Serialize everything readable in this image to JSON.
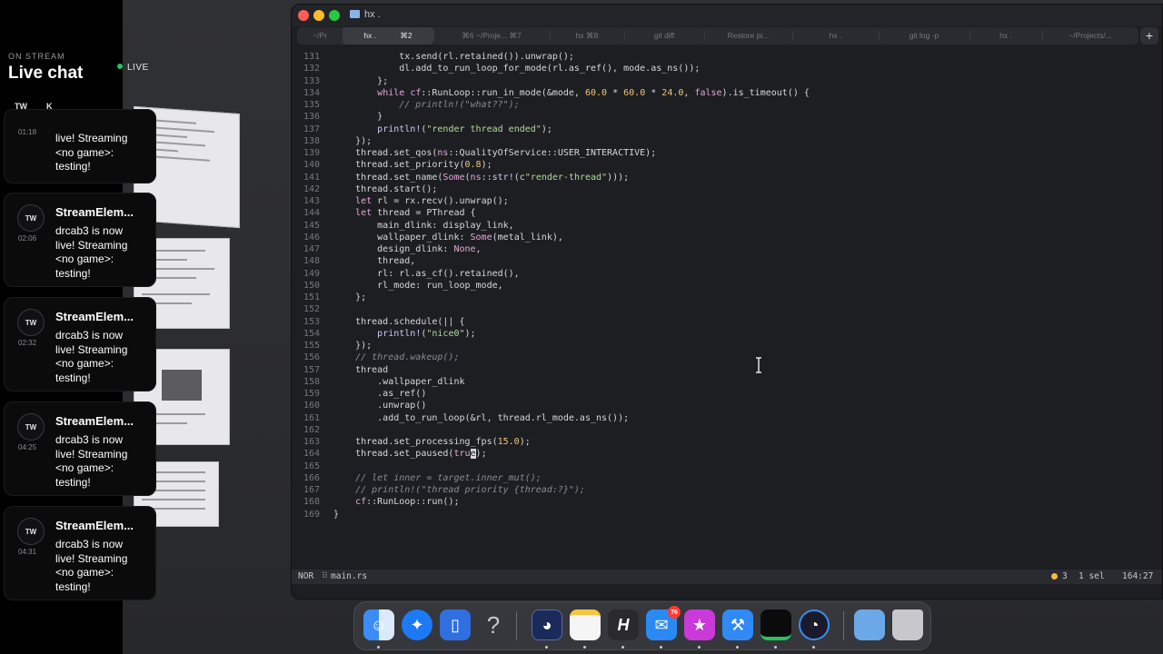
{
  "overlay": {
    "on_stream": "ON STREAM",
    "title": "Live chat",
    "live": "LIVE",
    "tabs": [
      "TW",
      "K"
    ],
    "messages": [
      {
        "platform": "TW",
        "time": "01:18",
        "name": "",
        "text": "live! Streaming <no game>: testing!"
      },
      {
        "platform": "TW",
        "time": "02:06",
        "name": "StreamElem...",
        "text": "drcab3 is now live! Streaming <no game>: testing!"
      },
      {
        "platform": "TW",
        "time": "02:32",
        "name": "StreamElem...",
        "text": "drcab3 is now live! Streaming <no game>: testing!"
      },
      {
        "platform": "TW",
        "time": "04:25",
        "name": "StreamElem...",
        "text": "drcab3 is now live! Streaming <no game>: testing!"
      },
      {
        "platform": "TW",
        "time": "04:31",
        "name": "StreamElem...",
        "text": "drcab3 is now live! Streaming <no game>: testing!"
      }
    ]
  },
  "editor": {
    "window_title": "hx .",
    "tabs": [
      {
        "label": "~/Pr"
      },
      {
        "label": "hx .",
        "shortcut": "⌘2",
        "active": true
      },
      {
        "label": "⌘6  ~/Proje...  ⌘7"
      },
      {
        "label": "hx  ⌘8"
      },
      {
        "label": "git diff"
      },
      {
        "label": "Restore pi..."
      },
      {
        "label": "hx ."
      },
      {
        "label": "git log -p"
      },
      {
        "label": "hx ."
      },
      {
        "label": "~/Projects/..."
      }
    ],
    "new_tab": "+",
    "tilde": "~",
    "status": {
      "mode": "NOR",
      "file_icon": "⠿",
      "filename": "main.rs",
      "diagnostics": "3",
      "selections": "1 sel",
      "position": "164:27"
    }
  },
  "dock": {
    "mail_badge": "76"
  },
  "colors": {
    "live_dot": "#22c55e",
    "close": "#ff5f57",
    "minimize": "#febc2e",
    "zoom": "#28c840",
    "diagnostic": "#f5b942"
  },
  "code": [
    {
      "n": "131",
      "t": "            tx.send(rl.retained()).unwrap();"
    },
    {
      "n": "132",
      "t": "            dl.add_to_run_loop_for_mode(rl.as_ref(), mode.as_ns());"
    },
    {
      "n": "133",
      "t": "        };"
    },
    {
      "n": "134",
      "t": "        while cf::RunLoop::run_in_mode(&mode, 60.0 * 60.0 * 24.0, false).is_timeout() {"
    },
    {
      "n": "135",
      "t": "            // println!(\"what??\");"
    },
    {
      "n": "136",
      "t": "        }"
    },
    {
      "n": "137",
      "t": "        println!(\"render thread ended\");"
    },
    {
      "n": "138",
      "t": "    });"
    },
    {
      "n": "139",
      "t": "    thread.set_qos(ns::QualityOfService::USER_INTERACTIVE);"
    },
    {
      "n": "140",
      "t": "    thread.set_priority(0.8);"
    },
    {
      "n": "141",
      "t": "    thread.set_name(Some(ns::str!(c\"render-thread\")));"
    },
    {
      "n": "142",
      "t": "    thread.start();"
    },
    {
      "n": "143",
      "t": "    let rl = rx.recv().unwrap();"
    },
    {
      "n": "144",
      "t": "    let thread = PThread {"
    },
    {
      "n": "145",
      "t": "        main_dlink: display_link,"
    },
    {
      "n": "146",
      "t": "        wallpaper_dlink: Some(metal_link),"
    },
    {
      "n": "147",
      "t": "        design_dlink: None,"
    },
    {
      "n": "148",
      "t": "        thread,"
    },
    {
      "n": "149",
      "t": "        rl: rl.as_cf().retained(),"
    },
    {
      "n": "150",
      "t": "        rl_mode: run_loop_mode,"
    },
    {
      "n": "151",
      "t": "    };"
    },
    {
      "n": "152",
      "t": ""
    },
    {
      "n": "153",
      "t": "    thread.schedule(|| {"
    },
    {
      "n": "154",
      "t": "        println!(\"nice0\");"
    },
    {
      "n": "155",
      "t": "    });"
    },
    {
      "n": "156",
      "t": "    // thread.wakeup();"
    },
    {
      "n": "157",
      "t": "    thread"
    },
    {
      "n": "158",
      "t": "        .wallpaper_dlink"
    },
    {
      "n": "159",
      "t": "        .as_ref()"
    },
    {
      "n": "160",
      "t": "        .unwrap()"
    },
    {
      "n": "161",
      "t": "        .add_to_run_loop(&rl, thread.rl_mode.as_ns());"
    },
    {
      "n": "162",
      "t": ""
    },
    {
      "n": "163",
      "t": "    thread.set_processing_fps(15.0);"
    },
    {
      "n": "164",
      "t": "    thread.set_paused(true);"
    },
    {
      "n": "165",
      "t": ""
    },
    {
      "n": "166",
      "t": "    // let inner = target.inner_mut();"
    },
    {
      "n": "167",
      "t": "    // println!(\"thread priority {thread:?}\");"
    },
    {
      "n": "168",
      "t": "    cf::RunLoop::run();"
    },
    {
      "n": "169",
      "t": "}"
    }
  ]
}
